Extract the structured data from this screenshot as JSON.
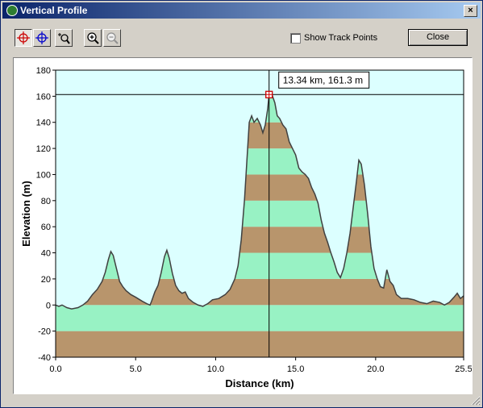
{
  "window": {
    "title": "Vertical Profile",
    "close_glyph": "×",
    "icon": "gps-app-icon"
  },
  "toolbar": {
    "tools": [
      {
        "name": "crosshair-red-tool",
        "icon": "crosshair-icon"
      },
      {
        "name": "crosshair-blue-tool",
        "icon": "crosshair-icon"
      },
      {
        "name": "zoom-box-tool",
        "icon": "zoom-box-icon"
      },
      {
        "name": "zoom-in-tool",
        "icon": "zoom-in-icon"
      },
      {
        "name": "zoom-out-tool",
        "icon": "zoom-out-icon"
      }
    ],
    "show_track_points_label": "Show Track Points",
    "show_track_points_checked": false,
    "close_label": "Close"
  },
  "cursor_readout": "13.34 km, 161.3 m",
  "colors": {
    "plot_bg": "#dcffff",
    "band_brown": "#b8956c",
    "band_green": "#98f2c4",
    "profile_line": "#404040"
  },
  "chart_data": {
    "type": "area",
    "xlabel": "Distance  (km)",
    "ylabel": "Elevation  (m)",
    "xlim": [
      0,
      25.5
    ],
    "ylim": [
      -40,
      180
    ],
    "xticks": [
      "0.0",
      "5.0",
      "10.0",
      "15.0",
      "20.0",
      "25.5"
    ],
    "xtick_values": [
      0,
      5,
      10,
      15,
      20,
      25.5
    ],
    "yticks": [
      180,
      160,
      140,
      120,
      100,
      80,
      60,
      40,
      20,
      0,
      -20,
      -40
    ],
    "band_height": 20,
    "cursor": {
      "x": 13.34,
      "y": 161.3
    },
    "profile": [
      [
        0,
        0
      ],
      [
        0.2,
        -1
      ],
      [
        0.4,
        0
      ],
      [
        0.7,
        -2
      ],
      [
        1.0,
        -3
      ],
      [
        1.4,
        -2
      ],
      [
        1.7,
        0
      ],
      [
        2.0,
        3
      ],
      [
        2.3,
        8
      ],
      [
        2.6,
        12
      ],
      [
        2.9,
        18
      ],
      [
        3.1,
        25
      ],
      [
        3.3,
        35
      ],
      [
        3.45,
        41
      ],
      [
        3.6,
        38
      ],
      [
        3.8,
        28
      ],
      [
        4.0,
        18
      ],
      [
        4.2,
        14
      ],
      [
        4.4,
        11
      ],
      [
        4.7,
        8
      ],
      [
        5.0,
        6
      ],
      [
        5.4,
        3
      ],
      [
        5.7,
        1
      ],
      [
        5.9,
        0
      ],
      [
        6.0,
        3
      ],
      [
        6.2,
        10
      ],
      [
        6.4,
        15
      ],
      [
        6.6,
        25
      ],
      [
        6.8,
        37
      ],
      [
        6.95,
        42
      ],
      [
        7.1,
        36
      ],
      [
        7.3,
        24
      ],
      [
        7.5,
        15
      ],
      [
        7.7,
        11
      ],
      [
        7.9,
        9
      ],
      [
        8.1,
        10
      ],
      [
        8.3,
        5
      ],
      [
        8.6,
        2
      ],
      [
        8.9,
        0
      ],
      [
        9.2,
        -1
      ],
      [
        9.5,
        1
      ],
      [
        9.8,
        4
      ],
      [
        10.2,
        5
      ],
      [
        10.6,
        8
      ],
      [
        10.9,
        12
      ],
      [
        11.2,
        20
      ],
      [
        11.4,
        30
      ],
      [
        11.6,
        50
      ],
      [
        11.8,
        80
      ],
      [
        11.95,
        110
      ],
      [
        12.1,
        140
      ],
      [
        12.25,
        145
      ],
      [
        12.4,
        140
      ],
      [
        12.6,
        143
      ],
      [
        12.8,
        138
      ],
      [
        12.95,
        132
      ],
      [
        13.1,
        138
      ],
      [
        13.25,
        150
      ],
      [
        13.34,
        161.3
      ],
      [
        13.5,
        162
      ],
      [
        13.7,
        155
      ],
      [
        13.85,
        145
      ],
      [
        14.0,
        143
      ],
      [
        14.2,
        138
      ],
      [
        14.4,
        135
      ],
      [
        14.6,
        125
      ],
      [
        14.8,
        120
      ],
      [
        15.0,
        115
      ],
      [
        15.2,
        105
      ],
      [
        15.4,
        102
      ],
      [
        15.6,
        100
      ],
      [
        15.8,
        97
      ],
      [
        16.0,
        90
      ],
      [
        16.2,
        85
      ],
      [
        16.4,
        78
      ],
      [
        16.6,
        65
      ],
      [
        16.8,
        55
      ],
      [
        17.0,
        48
      ],
      [
        17.2,
        40
      ],
      [
        17.4,
        33
      ],
      [
        17.6,
        25
      ],
      [
        17.8,
        21
      ],
      [
        18.0,
        28
      ],
      [
        18.2,
        40
      ],
      [
        18.4,
        55
      ],
      [
        18.6,
        75
      ],
      [
        18.8,
        95
      ],
      [
        18.95,
        111
      ],
      [
        19.1,
        108
      ],
      [
        19.3,
        92
      ],
      [
        19.5,
        70
      ],
      [
        19.7,
        45
      ],
      [
        19.9,
        28
      ],
      [
        20.1,
        20
      ],
      [
        20.3,
        14
      ],
      [
        20.5,
        13
      ],
      [
        20.6,
        20
      ],
      [
        20.7,
        27
      ],
      [
        20.9,
        18
      ],
      [
        21.1,
        15
      ],
      [
        21.3,
        8
      ],
      [
        21.6,
        5
      ],
      [
        22.0,
        5
      ],
      [
        22.4,
        4
      ],
      [
        22.8,
        2
      ],
      [
        23.2,
        1
      ],
      [
        23.6,
        3
      ],
      [
        24.0,
        2
      ],
      [
        24.3,
        0
      ],
      [
        24.6,
        2
      ],
      [
        24.9,
        6
      ],
      [
        25.1,
        9
      ],
      [
        25.3,
        5
      ],
      [
        25.5,
        7
      ]
    ]
  }
}
